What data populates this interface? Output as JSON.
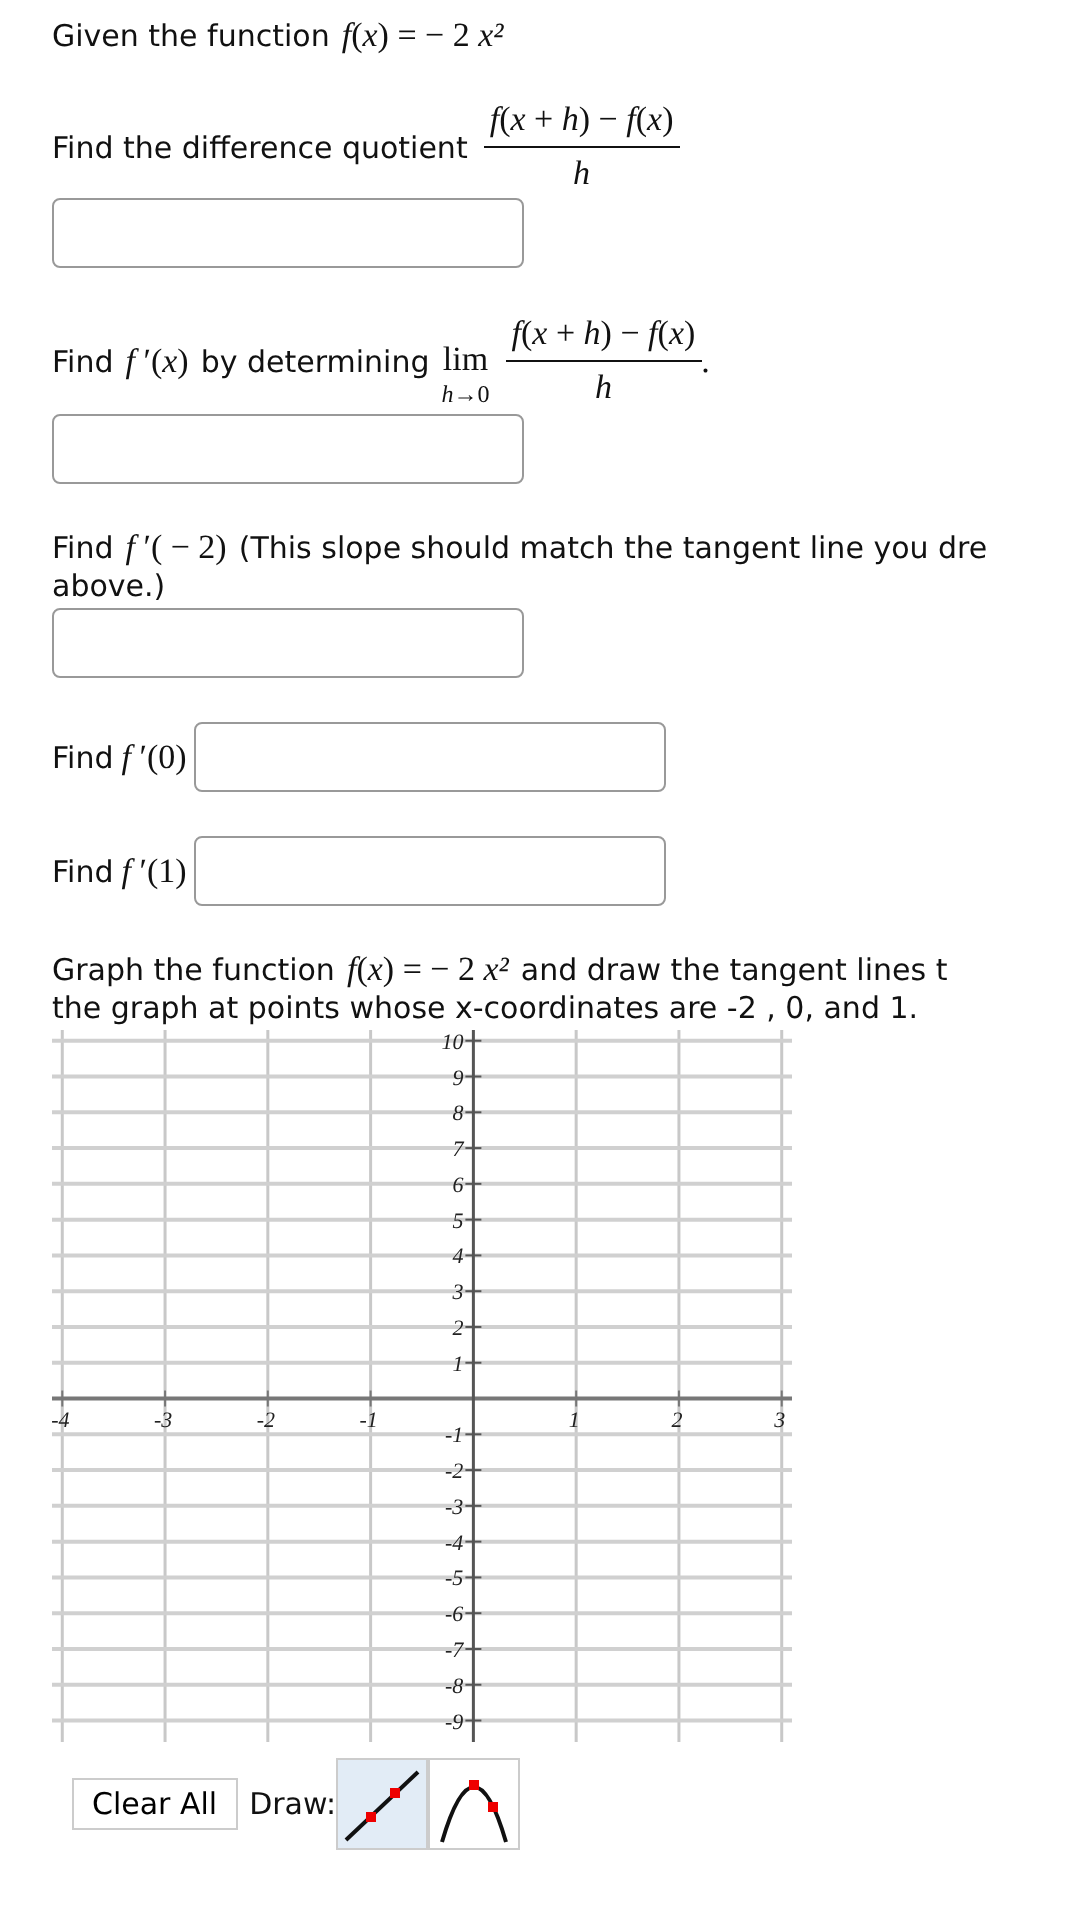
{
  "questions": [
    {
      "kind": "statement",
      "prompt": "Given the function",
      "formula": "*f*(*x*) = − 2 *x²*"
    },
    {
      "kind": "fraction",
      "prompt": "Find the difference quotient",
      "numerator": "*f*(*x* + *h*) − *f*(*x*)",
      "denominator": "*h*",
      "answer_field": true
    },
    {
      "kind": "limit",
      "prompt": "Find",
      "formula": "*f* ′(*x*)",
      "prompt_after": "by determining",
      "limit": "lim",
      "limit_sub": "*h*→0",
      "numerator": "*f*(*x* + *h*) − *f*(*x*)",
      "denominator": "*h*",
      "trailing": ".",
      "answer_field": true
    },
    {
      "kind": "statement",
      "prompt": "Find",
      "formula": "*f* ′( − 2)",
      "text_lines": [
        "(This slope should match the tangent line you dre",
        "above.)"
      ],
      "answer_field": true
    },
    {
      "kind": "inline-answer",
      "prompt": "Find",
      "formula": "*f* ′(0)"
    },
    {
      "kind": "inline-answer",
      "prompt": "Find",
      "formula": "*f* ′(1)"
    },
    {
      "kind": "statement",
      "prompt": "Graph the function",
      "formula": "*f*(*x*) = − 2 *x²*",
      "text_lines": [
        "and draw the tangent lines t",
        "the graph at points whose x-coordinates are -2 , 0, and 1."
      ]
    }
  ],
  "graph": {
    "chart_data": {
      "type": "line",
      "grid": true,
      "xlim": [
        -4.1,
        3.1
      ],
      "ylim": [
        -9.6,
        10.3
      ],
      "xticks": [
        -4,
        -3,
        -2,
        -1,
        1,
        2,
        3
      ],
      "yticks": [
        -9,
        -8,
        -7,
        -6,
        -5,
        -4,
        -3,
        -2,
        -1,
        1,
        2,
        3,
        4,
        5,
        6,
        7,
        8,
        9,
        10
      ]
    }
  },
  "toolbar": {
    "clear_label": "Clear All",
    "draw_label": "Draw:",
    "tools": [
      {
        "kind": "line",
        "selected": true
      },
      {
        "kind": "parabola",
        "selected": false
      }
    ]
  }
}
